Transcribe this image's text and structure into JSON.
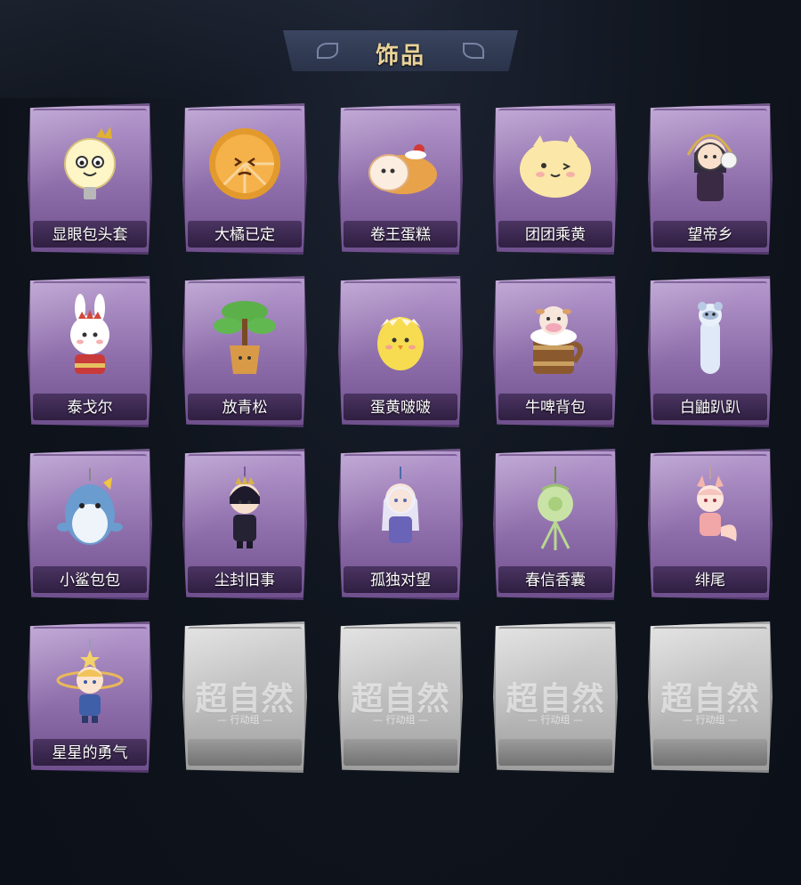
{
  "page": {
    "title": "饰品"
  },
  "colors": {
    "background": "#0f141d",
    "banner": "#2e3850",
    "title_text": "#ead39a",
    "card_purple": "#9b7bb8",
    "card_locked": "#c4c4c4"
  },
  "items": [
    {
      "label": "显眼包头套",
      "icon": "lightbulb-mascot-icon",
      "locked": false
    },
    {
      "label": "大橘已定",
      "icon": "orange-slice-icon",
      "locked": false
    },
    {
      "label": "卷王蛋糕",
      "icon": "roll-cake-icon",
      "locked": false
    },
    {
      "label": "团团乘黄",
      "icon": "round-cat-bun-icon",
      "locked": false
    },
    {
      "label": "望帝乡",
      "icon": "chibi-emperor-icon",
      "locked": false
    },
    {
      "label": "泰戈尔",
      "icon": "crowned-bunny-icon",
      "locked": false
    },
    {
      "label": "放青松",
      "icon": "bonsai-pine-icon",
      "locked": false
    },
    {
      "label": "蛋黄啵啵",
      "icon": "hatching-chick-icon",
      "locked": false
    },
    {
      "label": "牛啤背包",
      "icon": "cow-beer-mug-icon",
      "locked": false
    },
    {
      "label": "白鼬趴趴",
      "icon": "white-ferret-icon",
      "locked": false
    },
    {
      "label": "小鲨包包",
      "icon": "shark-plush-icon",
      "locked": false
    },
    {
      "label": "尘封旧事",
      "icon": "chibi-prince-charm-icon",
      "locked": false
    },
    {
      "label": "孤独对望",
      "icon": "chibi-white-hair-charm-icon",
      "locked": false
    },
    {
      "label": "春信香囊",
      "icon": "green-sachet-icon",
      "locked": false
    },
    {
      "label": "绯尾",
      "icon": "fox-girl-charm-icon",
      "locked": false
    },
    {
      "label": "星星的勇气",
      "icon": "star-boy-charm-icon",
      "locked": false
    },
    {
      "label": "",
      "icon": "locked-placeholder",
      "locked": true,
      "watermark": "超自然",
      "watermark_sub": "— 行动组 —"
    },
    {
      "label": "",
      "icon": "locked-placeholder",
      "locked": true,
      "watermark": "超自然",
      "watermark_sub": "— 行动组 —"
    },
    {
      "label": "",
      "icon": "locked-placeholder",
      "locked": true,
      "watermark": "超自然",
      "watermark_sub": "— 行动组 —"
    },
    {
      "label": "",
      "icon": "locked-placeholder",
      "locked": true,
      "watermark": "超自然",
      "watermark_sub": "— 行动组 —"
    }
  ]
}
